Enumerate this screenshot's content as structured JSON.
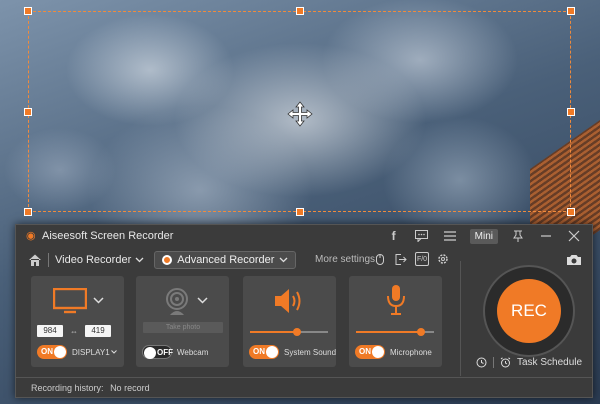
{
  "app": {
    "title": "Aiseesoft Screen Recorder",
    "mini_label": "Mini"
  },
  "toolbar": {
    "video_recorder_label": "Video Recorder",
    "advanced_recorder_label": "Advanced Recorder",
    "more_settings_label": "More settings:"
  },
  "display_panel": {
    "width": "984",
    "height": "419",
    "toggle": "ON",
    "display_label": "DISPLAY1"
  },
  "webcam_panel": {
    "take_photo_label": "Take photo",
    "toggle": "OFF",
    "label": "Webcam"
  },
  "sound_panel": {
    "toggle": "ON",
    "label": "System Sound",
    "volume": 0.6
  },
  "mic_panel": {
    "toggle": "ON",
    "label": "Microphone",
    "volume": 0.83
  },
  "rec_button": {
    "label": "REC"
  },
  "schedule": {
    "label": "Task Schedule"
  },
  "footer": {
    "history_label": "Recording history:",
    "history_value": "No record"
  },
  "colors": {
    "accent": "#f07a26",
    "window_bg": "#3b3b3b",
    "panel_bg": "#4b4b4b"
  }
}
